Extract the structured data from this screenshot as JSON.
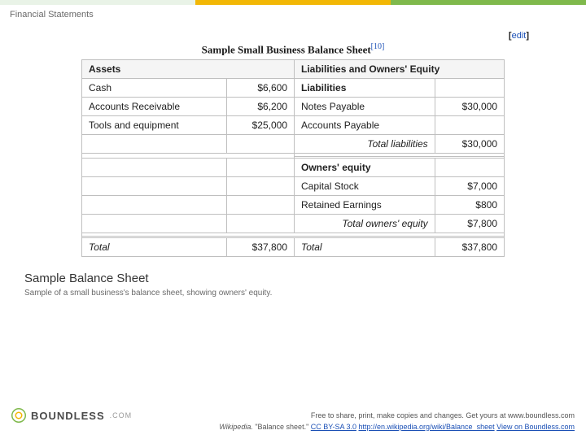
{
  "header": {
    "title": "Financial Statements"
  },
  "edit": {
    "open": "[",
    "label": "edit",
    "close": "]"
  },
  "figure": {
    "title": "Sample Small Business Balance Sheet",
    "ref": "[10]"
  },
  "table": {
    "head": {
      "left": "Assets",
      "right": "Liabilities and Owners' Equity"
    },
    "rows": {
      "r1": {
        "a": "Cash",
        "av": "$6,600",
        "b": "Liabilities",
        "bv": ""
      },
      "r2": {
        "a": "Accounts Receivable",
        "av": "$6,200",
        "b": "Notes Payable",
        "bv": "$30,000"
      },
      "r3": {
        "a": "Tools and equipment",
        "av": "$25,000",
        "b": "Accounts Payable",
        "bv": ""
      },
      "r4": {
        "a": "",
        "av": "",
        "b": "Total liabilities",
        "bv": "$30,000"
      },
      "r5": {
        "a": "",
        "av": "",
        "b": "Owners' equity",
        "bv": ""
      },
      "r6": {
        "a": "",
        "av": "",
        "b": "Capital Stock",
        "bv": "$7,000"
      },
      "r7": {
        "a": "",
        "av": "",
        "b": "Retained Earnings",
        "bv": "$800"
      },
      "r8": {
        "a": "",
        "av": "",
        "b": "Total owners' equity",
        "bv": "$7,800"
      },
      "r9": {
        "a": "Total",
        "av": "$37,800",
        "b": "Total",
        "bv": "$37,800"
      }
    }
  },
  "caption": {
    "title": "Sample Balance Sheet",
    "sub": "Sample of a small business's balance sheet, showing owners' equity."
  },
  "footer": {
    "line1": "Free to share, print, make copies and changes. Get yours at www.boundless.com",
    "src_prefix": "Wikipedia. ",
    "src_quote": "\"Balance sheet.\" ",
    "license": "CC BY-SA 3.0",
    "sep": " ",
    "url": "http://en.wikipedia.org/wiki/Balance_sheet",
    "view": "View on Boundless.com"
  },
  "brand": {
    "name": "BOUNDLESS",
    "tld": ".COM"
  }
}
